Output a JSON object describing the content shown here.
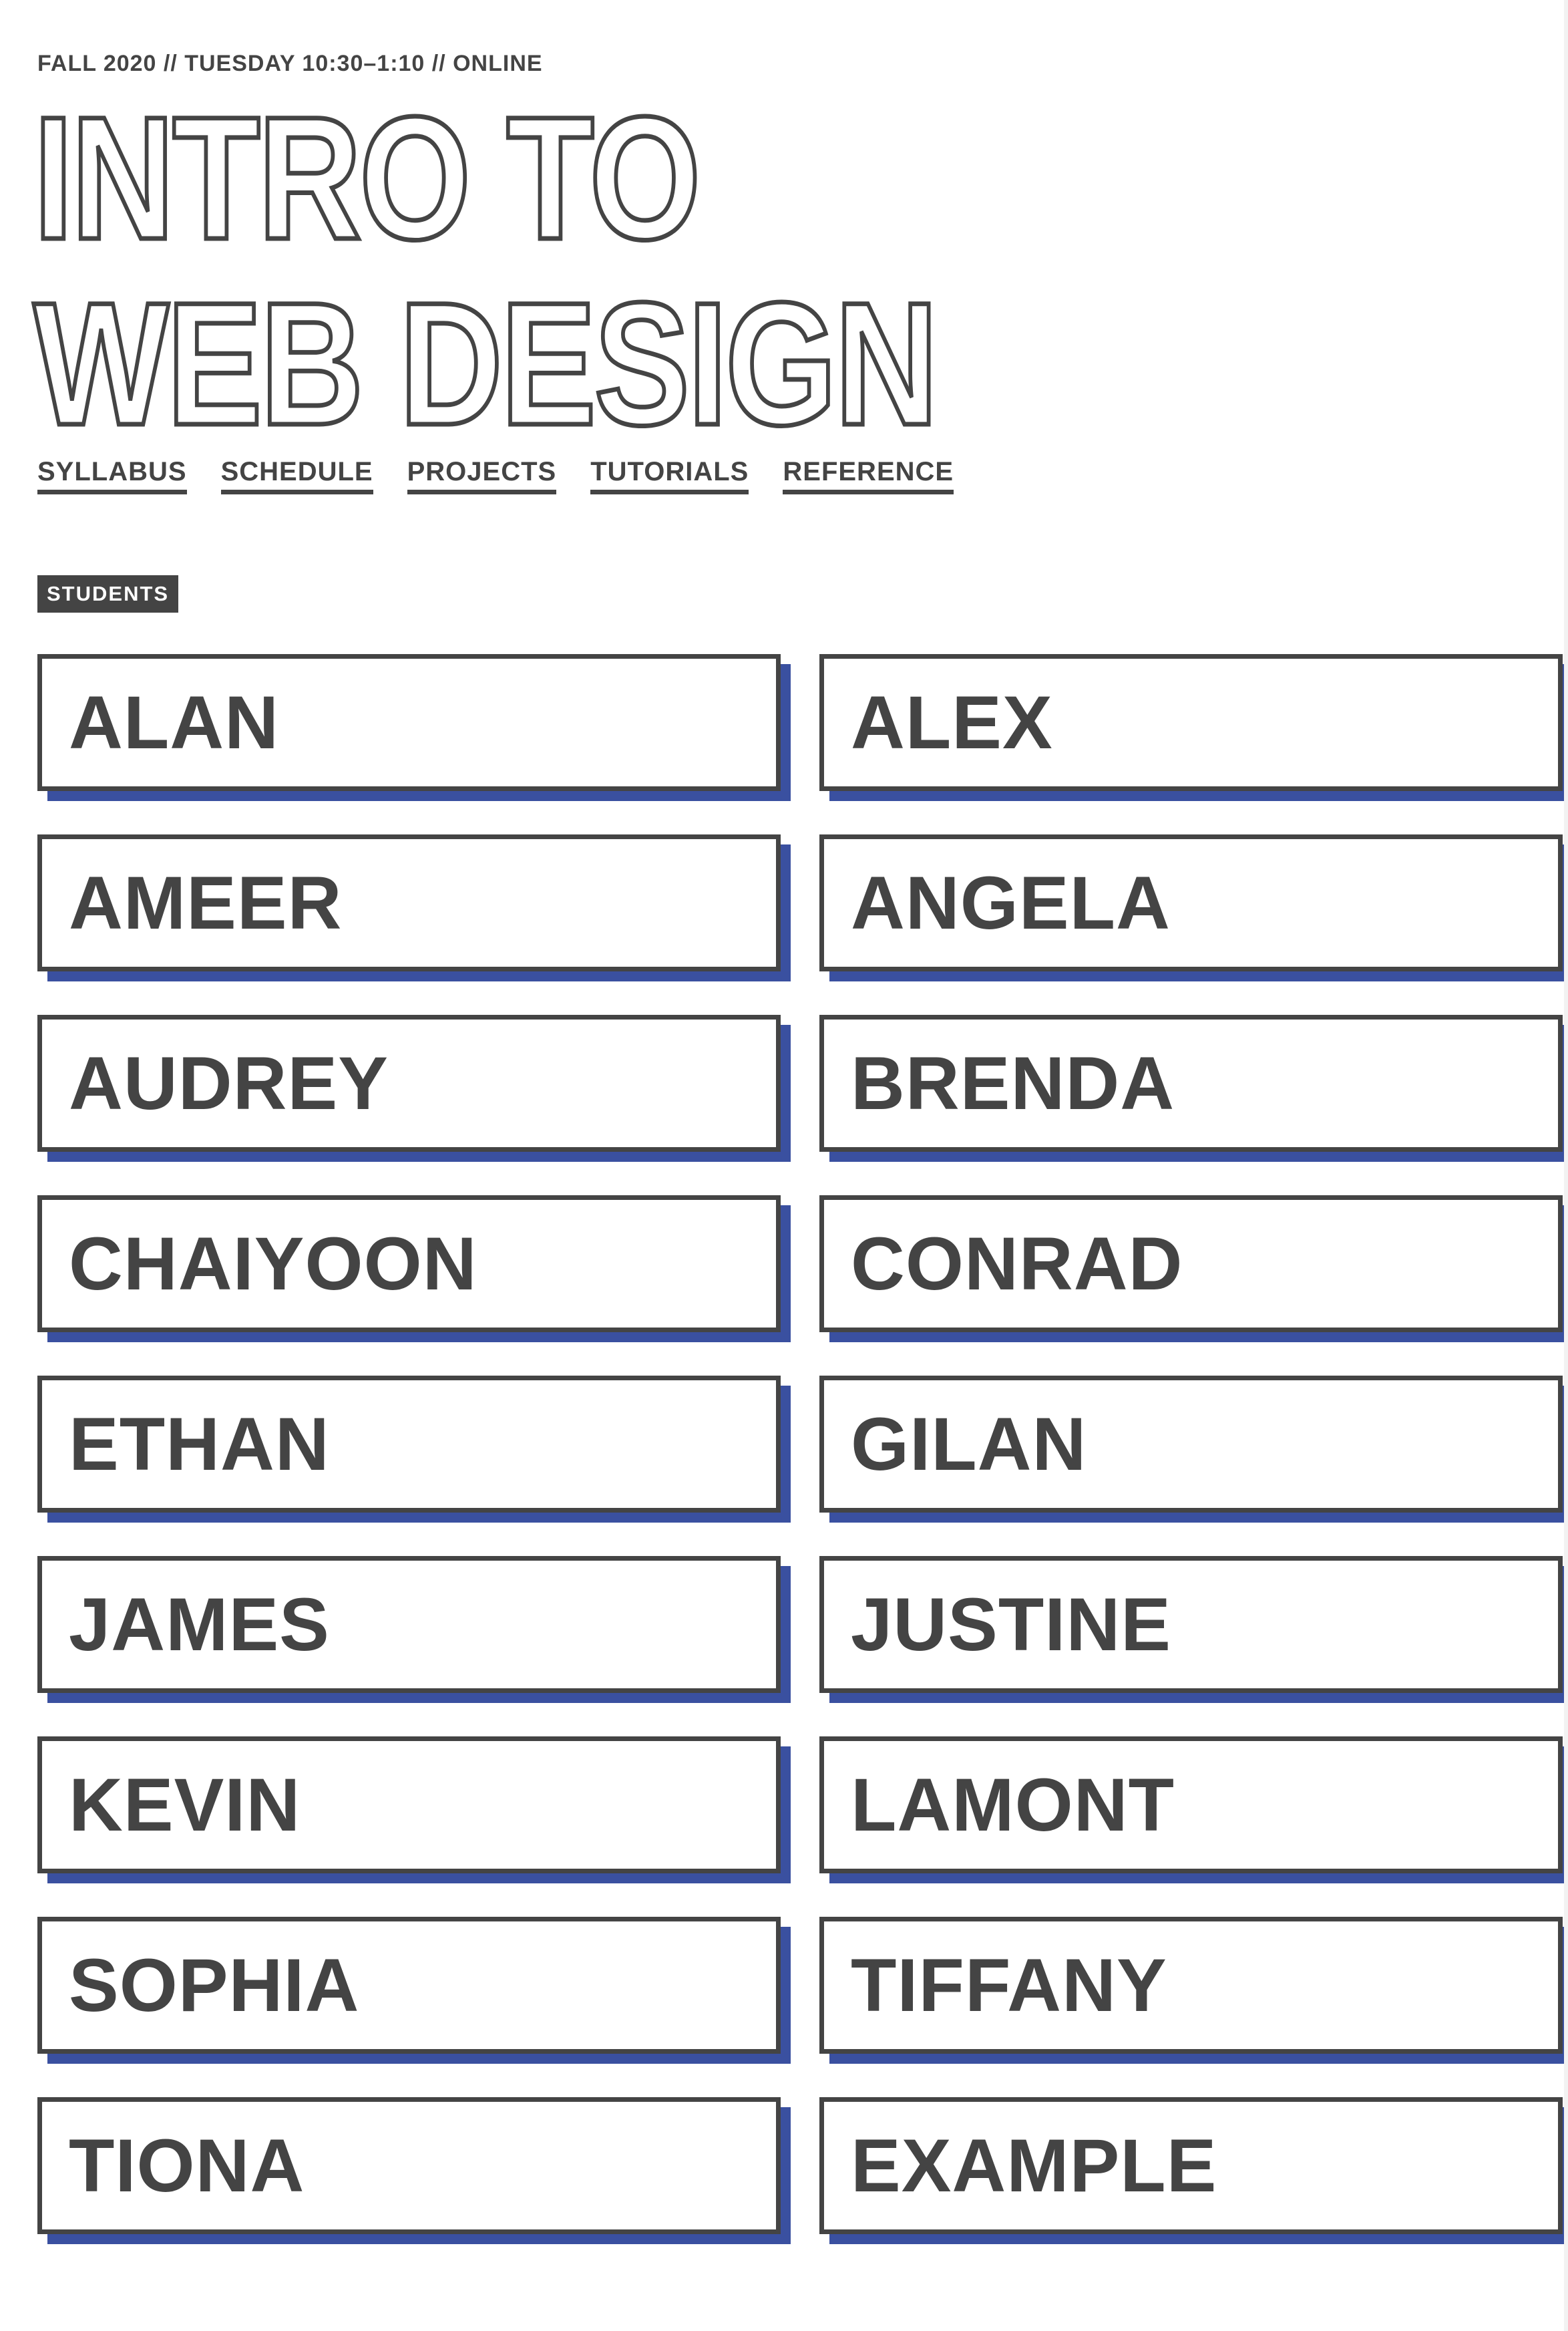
{
  "header": {
    "meta": "FALL 2020 // TUESDAY 10:30–1:10 // ONLINE",
    "title_line1": "INTRO TO",
    "title_line2": "WEB DESIGN"
  },
  "nav": [
    "SYLLABUS",
    "SCHEDULE",
    "PROJECTS",
    "TUTORIALS",
    "REFERENCE"
  ],
  "section_label": "STUDENTS",
  "students": [
    "ALAN",
    "ALEX",
    "AMEER",
    "ANGELA",
    "AUDREY",
    "BRENDA",
    "CHAIYOON",
    "CONRAD",
    "ETHAN",
    "GILAN",
    "JAMES",
    "JUSTINE",
    "KEVIN",
    "LAMONT",
    "SOPHIA",
    "TIFFANY",
    "TIONA",
    "EXAMPLE"
  ],
  "colors": {
    "text": "#444444",
    "shadow": "#3a50a0"
  }
}
